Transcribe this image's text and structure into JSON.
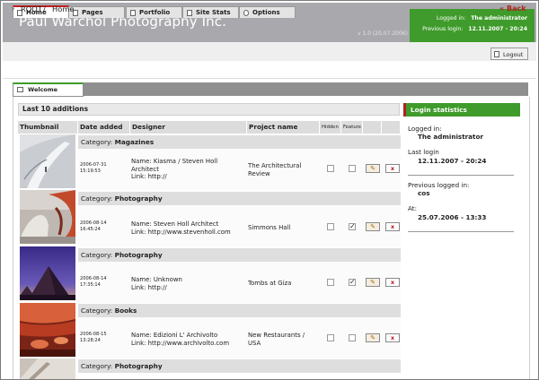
{
  "app": {
    "title": "Paul Warchol Photography Inc.",
    "version": "v 1.0 (20.07.2006)"
  },
  "login_box": {
    "logged_in_label": "Logged in:",
    "logged_in_value": "The administrator",
    "previous_label": "Previous login:",
    "previous_value": "12.11.2007 - 20:24"
  },
  "tabs": [
    {
      "label": "Home",
      "active": true
    },
    {
      "label": "Pages"
    },
    {
      "label": "Portfolio"
    },
    {
      "label": "Site Stats"
    },
    {
      "label": "Options"
    }
  ],
  "logout_label": "Logout",
  "breadcrumb": {
    "root": "ROOT",
    "sep": "/",
    "current": "Home"
  },
  "back_label": "Back",
  "panel_tab": "Welcome",
  "section_title": "Last 10 additions",
  "columns": {
    "thumbnail": "Thumbnail",
    "date_added": "Date added",
    "designer": "Designer",
    "project_name": "Project name",
    "hidden": "Hidden",
    "feature": "Feature"
  },
  "category_label": "Category:",
  "rows": [
    {
      "category": "Magazines",
      "date": "2006-07-31",
      "time": "15:19:53",
      "designer_name": "Name: Kiasma / Steven Holl",
      "designer_name2": "Architect",
      "designer_link": "Link: http://",
      "project": "The Architectural",
      "project2": "Review",
      "hidden": false,
      "feature": false
    },
    {
      "category": "Photography",
      "date": "2006-08-14",
      "time": "16:45:24",
      "designer_name": "Name: Steven Holl Architect",
      "designer_name2": "",
      "designer_link": "Link: http://www.stevenholl.com",
      "project": "Simmons Hall",
      "project2": "",
      "hidden": false,
      "feature": true
    },
    {
      "category": "Photography",
      "date": "2006-08-14",
      "time": "17:35:14",
      "designer_name": "Name: Unknown",
      "designer_name2": "",
      "designer_link": "Link: http://",
      "project": "Tombs at Giza",
      "project2": "",
      "hidden": false,
      "feature": true
    },
    {
      "category": "Books",
      "date": "2006-08-15",
      "time": "13:28:24",
      "designer_name": "Name: Edizioni L' Archivolto",
      "designer_name2": "",
      "designer_link": "Link: http://www.archivolto.com",
      "project": "New Restaurants /",
      "project2": "USA",
      "hidden": false,
      "feature": false
    },
    {
      "category": "Photography"
    }
  ],
  "buttons": {
    "edit_icon": "pencil-icon",
    "delete": "x"
  },
  "stats": {
    "title": "Login statistics",
    "logged_in_label": "Logged in:",
    "logged_in_value": "The administrator",
    "last_login_label": "Last login",
    "last_login_value": "12.11.2007 - 20:24",
    "previous_label": "Previous logged in:",
    "previous_value": "cos",
    "at_label": "At:",
    "at_value": "25.07.2006 - 13:33"
  },
  "colors": {
    "accent_green": "#3f9b2b",
    "accent_red": "#b32020",
    "header_gray": "#a9a9ad"
  }
}
